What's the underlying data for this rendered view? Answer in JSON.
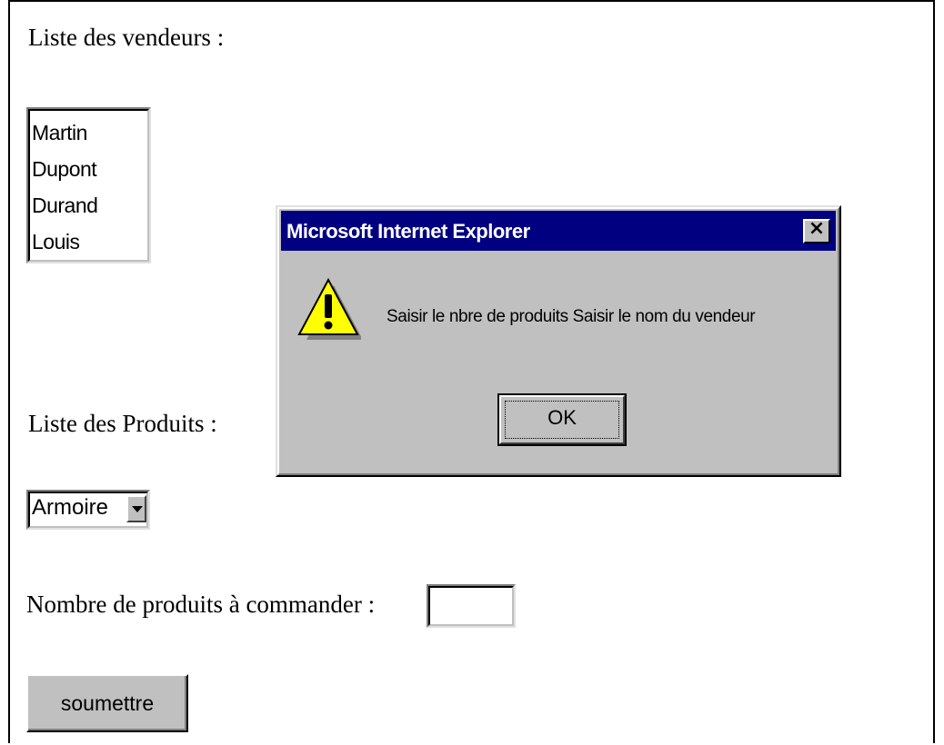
{
  "page": {
    "vendors_label": "Liste des vendeurs :",
    "vendors": [
      "Martin",
      "Dupont",
      "Durand",
      "Louis"
    ],
    "products_label": "Liste des Produits :",
    "product_selected": "Armoire",
    "quantity_label": "Nombre de produits à commander :",
    "quantity_value": "",
    "submit_label": "soumettre"
  },
  "dialog": {
    "title": "Microsoft Internet Explorer",
    "close_glyph": "×",
    "icon": "warning-icon",
    "message": "Saisir le nbre de produits Saisir le nom du vendeur",
    "ok_label": "OK"
  },
  "colors": {
    "titlebar": "#000080",
    "dialog_bg": "#c0c0c0",
    "warning_yellow": "#ffff00"
  }
}
